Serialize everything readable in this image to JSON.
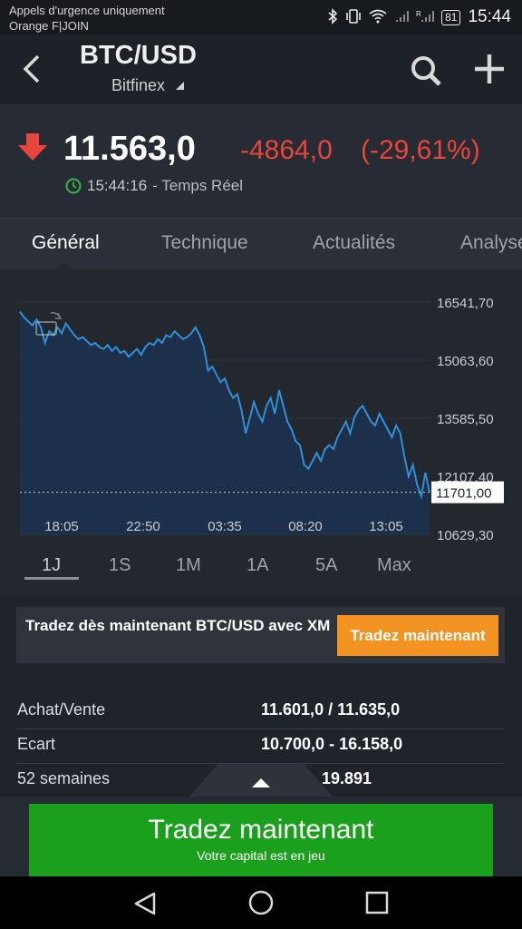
{
  "status_bar": {
    "carrier_line1": "Appels d'urgence uniquement",
    "carrier_line2": "Orange F|JOIN",
    "battery": "81",
    "time": "15:44",
    "icons": [
      "bluetooth-icon",
      "vibrate-icon",
      "wifi-icon",
      "signal-icon",
      "signal-r-icon",
      "battery-icon"
    ]
  },
  "app_bar": {
    "title": "BTC/USD",
    "exchange": "Bitfinex",
    "icons": [
      "back-arrow-icon",
      "search-icon",
      "plus-icon"
    ]
  },
  "quote": {
    "price": "11.563,0",
    "change": "-4864,0",
    "change_pct": "(-29,61%)",
    "time": "15:44:16",
    "time_suffix": "- Temps Réel",
    "direction": "down",
    "down_color": "#e8453c"
  },
  "tabs": [
    {
      "label": "Général",
      "active": true
    },
    {
      "label": "Technique",
      "active": false
    },
    {
      "label": "Actualités",
      "active": false
    },
    {
      "label": "Analyse",
      "active": false
    }
  ],
  "chart_data": {
    "type": "area",
    "x_tick_labels": [
      "18:05",
      "22:50",
      "03:35",
      "08:20",
      "13:05"
    ],
    "y_tick_labels": [
      "16541,70",
      "15063,60",
      "13585,50",
      "12107,40",
      "10629,30"
    ],
    "ylim": [
      10629.3,
      16541.7
    ],
    "current_value_label": "11701,00",
    "current_value": 11701.0,
    "line_color": "#2f8fd8",
    "series": [
      {
        "values": [
          16300,
          16150,
          16050,
          15950,
          16100,
          15900,
          15500,
          15800,
          15700,
          15900,
          15750,
          16000,
          15850,
          15700,
          15600,
          15650,
          15550,
          15450,
          15500,
          15400,
          15350,
          15450,
          15300,
          15400,
          15250,
          15300,
          15150,
          15250,
          15350,
          15200,
          15400,
          15500,
          15450,
          15600,
          15500,
          15700,
          15650,
          15800,
          15700,
          15600,
          15650,
          15750,
          15900,
          15700,
          15400,
          14800,
          14900,
          14700,
          14500,
          14600,
          14300,
          14100,
          14200,
          13800,
          13200,
          13600,
          14000,
          13700,
          13500,
          13900,
          14100,
          13700,
          14300,
          13900,
          13500,
          13300,
          13000,
          12900,
          12400,
          12300,
          12500,
          12700,
          12500,
          12800,
          12900,
          12800,
          13100,
          13300,
          13500,
          13200,
          13600,
          13800,
          13900,
          13700,
          13500,
          13400,
          13700,
          13500,
          13300,
          13100,
          13400,
          13200,
          12600,
          12100,
          12400,
          11900,
          11600,
          12200,
          11701
        ]
      }
    ]
  },
  "ranges": [
    {
      "label": "1J",
      "active": true
    },
    {
      "label": "1S",
      "active": false
    },
    {
      "label": "1M",
      "active": false
    },
    {
      "label": "1A",
      "active": false
    },
    {
      "label": "5A",
      "active": false
    },
    {
      "label": "Max",
      "active": false
    }
  ],
  "promo": {
    "text": "Tradez dès maintenant BTC/USD avec XM",
    "button": "Tradez maintenant",
    "button_color": "#f39321"
  },
  "details": [
    {
      "label": "Achat/Vente",
      "value": "11.601,0 / 11.635,0"
    },
    {
      "label": "Ecart",
      "value": "10.700,0 - 16.158,0"
    },
    {
      "label": "52 semaines",
      "value": "19.891"
    }
  ],
  "cta": {
    "title": "Tradez maintenant",
    "subtitle": "Votre capital est en jeu",
    "color": "#1aa01c"
  },
  "nav_bar": {
    "icons": [
      "back-triangle-icon",
      "home-circle-icon",
      "recents-square-icon"
    ]
  }
}
